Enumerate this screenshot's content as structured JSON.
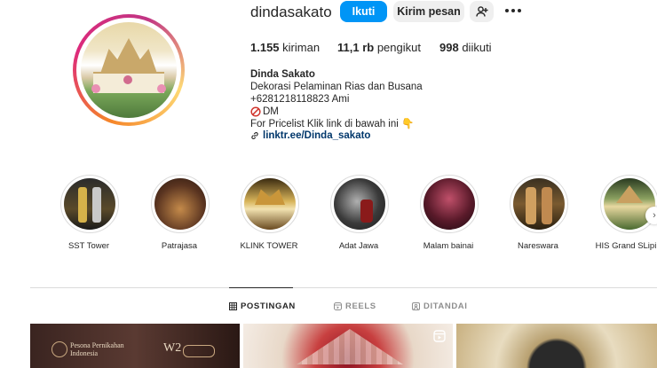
{
  "profile": {
    "username": "dindasakato",
    "follow_label": "Ikuti",
    "message_label": "Kirim pesan"
  },
  "stats": {
    "posts_count": "1.155",
    "posts_label": "kiriman",
    "followers_count": "11,1 rb",
    "followers_label": "pengikut",
    "following_count": "998",
    "following_label": "diikuti"
  },
  "bio": {
    "name": "Dinda Sakato",
    "line1": "Dekorasi Pelaminan Rias dan Busana",
    "line2": "+6281218118823 Ami",
    "line3": "DM",
    "line4": "For Pricelist Klik link di bawah ini",
    "link": "linktr.ee/Dinda_sakato"
  },
  "highlights": [
    {
      "label": "SST Tower"
    },
    {
      "label": "Patrajasa"
    },
    {
      "label": "KLINK TOWER"
    },
    {
      "label": "Adat Jawa"
    },
    {
      "label": "Malam bainai"
    },
    {
      "label": "Nareswara"
    },
    {
      "label": "HIS Grand SLipi"
    }
  ],
  "tabs": {
    "posts": "POSTINGAN",
    "reels": "REELS",
    "tagged": "DITANDAI"
  },
  "posts": [
    {
      "line1": "Pesona Pernikahan",
      "line2": "Indonesia",
      "badge": "W2"
    }
  ],
  "colors": {
    "accent": "#0095f6",
    "link": "#00376b",
    "secondary_button": "#efefef"
  }
}
